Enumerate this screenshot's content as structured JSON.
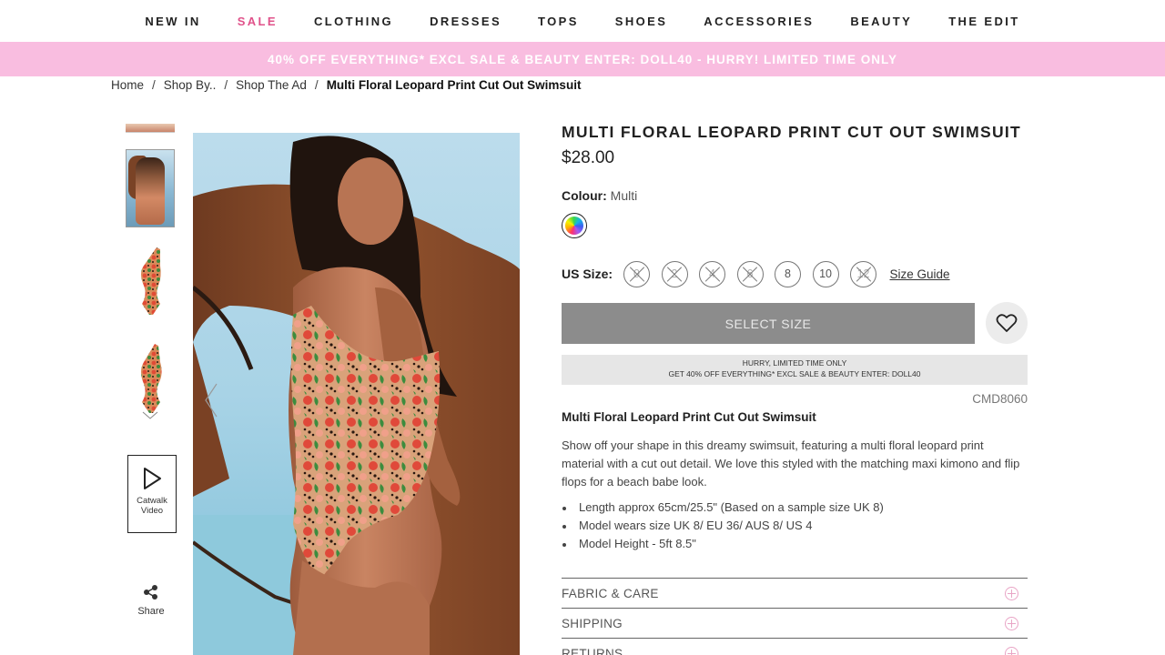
{
  "nav": {
    "items": [
      {
        "label": "NEW IN"
      },
      {
        "label": "SALE"
      },
      {
        "label": "CLOTHING"
      },
      {
        "label": "DRESSES"
      },
      {
        "label": "TOPS"
      },
      {
        "label": "SHOES"
      },
      {
        "label": "ACCESSORIES"
      },
      {
        "label": "BEAUTY"
      },
      {
        "label": "THE EDIT"
      }
    ]
  },
  "promo": {
    "text": "40% OFF EVERYTHING* EXCL SALE & BEAUTY ENTER: DOLL40 - HURRY! LIMITED TIME ONLY",
    "color": "#f9bde0"
  },
  "breadcrumb": {
    "items": [
      "Home",
      "Shop By..",
      "Shop The Ad"
    ],
    "separator": "/",
    "current": "Multi Floral Leopard Print Cut Out Swimsuit"
  },
  "gallery": {
    "catwalk_label": "Catwalk Video",
    "share_label": "Share",
    "icons": [
      "play-icon",
      "share-icon",
      "chevron-down-icon",
      "chevron-left-icon"
    ]
  },
  "product": {
    "title": "MULTI FLORAL LEOPARD PRINT CUT OUT SWIMSUIT",
    "price": "$28.00",
    "colour_label": "Colour:",
    "colour_value": "Multi",
    "size_label": "US Size:",
    "sizes": [
      {
        "label": "0",
        "available": false
      },
      {
        "label": "2",
        "available": false
      },
      {
        "label": "4",
        "available": false
      },
      {
        "label": "6",
        "available": false
      },
      {
        "label": "8",
        "available": true
      },
      {
        "label": "10",
        "available": true
      },
      {
        "label": "12",
        "available": false
      }
    ],
    "size_guide": "Size Guide",
    "select_button": "SELECT SIZE",
    "hurry_line1": "HURRY, LIMITED TIME ONLY",
    "hurry_line2": "GET 40% OFF EVERYTHING* EXCL SALE & BEAUTY ENTER: DOLL40",
    "sku": "CMD8060",
    "desc_title": "Multi Floral Leopard Print Cut Out Swimsuit",
    "description": "Show off your shape in this dreamy swimsuit, featuring a multi floral leopard print material with a cut out detail. We love this styled with the matching maxi kimono and flip flops for a beach babe look.",
    "bullets": [
      "Length approx 65cm/25.5\" (Based on a sample size UK 8)",
      "Model wears size UK 8/ EU 36/ AUS 8/ US 4",
      "Model Height - 5ft 8.5\""
    ],
    "accordions": [
      {
        "label": "FABRIC & CARE"
      },
      {
        "label": "SHIPPING"
      },
      {
        "label": "RETURNS"
      }
    ]
  },
  "colors": {
    "accent": "#e0528a",
    "promo_bg": "#f9bde0",
    "button_bg": "#8c8c8c"
  }
}
